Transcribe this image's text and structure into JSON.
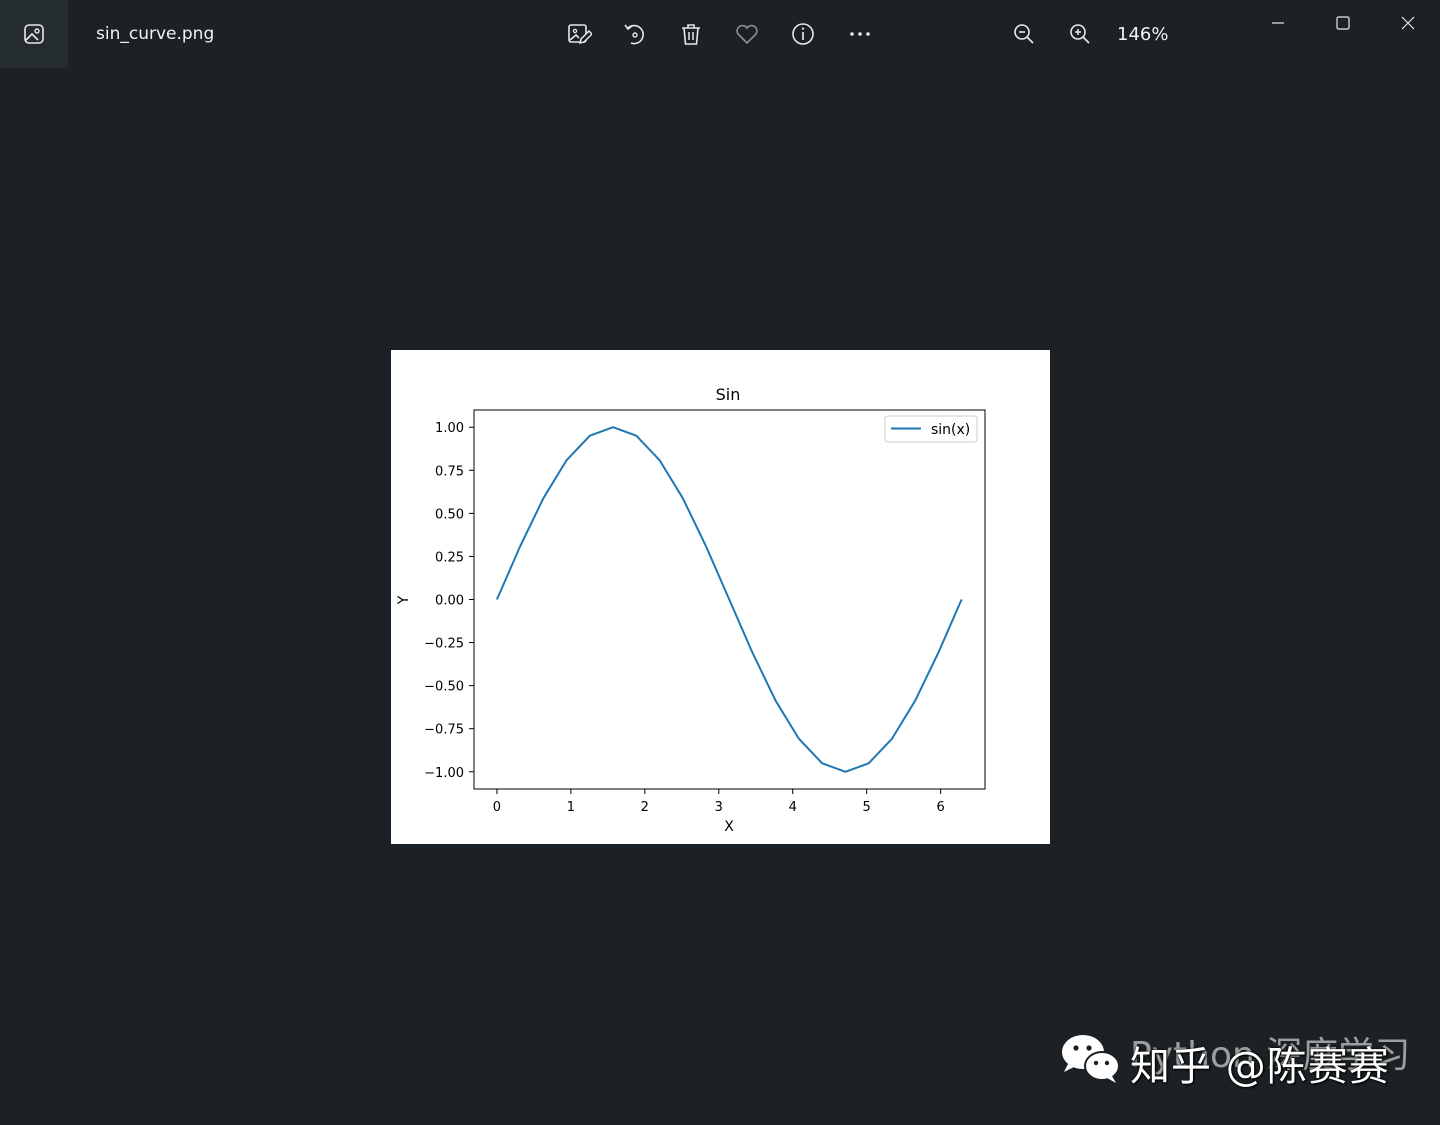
{
  "window": {
    "filename": "sin_curve.png",
    "zoom_level": "146%",
    "toolbar": {
      "edit_icon": "edit-image-icon",
      "rotate_icon": "rotate-icon",
      "delete_icon": "delete-icon",
      "favorite_icon": "heart-icon",
      "info_icon": "info-icon",
      "more_icon": "more-icon",
      "zoom_out_icon": "zoom-out-icon",
      "zoom_in_icon": "zoom-in-icon"
    },
    "controls": [
      "minimize-icon",
      "maximize-icon",
      "close-icon"
    ]
  },
  "chart_data": {
    "type": "line",
    "title": "Sin",
    "xlabel": "X",
    "ylabel": "Y",
    "xlim": [
      -0.31,
      6.6
    ],
    "ylim": [
      -1.1,
      1.1
    ],
    "x_ticks": [
      "0",
      "1",
      "2",
      "3",
      "4",
      "5",
      "6"
    ],
    "y_ticks": [
      "1.00",
      "0.75",
      "0.50",
      "0.25",
      "0.00",
      "−0.25",
      "−0.50",
      "−0.75",
      "−1.00"
    ],
    "legend": {
      "position": "upper-right"
    },
    "grid": false,
    "series": [
      {
        "name": "sin(x)",
        "color": "#1f77b4",
        "x": [
          0,
          0.3142,
          0.6283,
          0.9425,
          1.2566,
          1.5708,
          1.885,
          2.1991,
          2.5133,
          2.8274,
          3.1416,
          3.4558,
          3.7699,
          4.0841,
          4.3982,
          4.7124,
          5.0265,
          5.3407,
          5.6549,
          5.969,
          6.2832
        ],
        "y": [
          0,
          0.309,
          0.588,
          0.809,
          0.951,
          1.0,
          0.951,
          0.809,
          0.588,
          0.309,
          0,
          -0.309,
          -0.588,
          -0.809,
          -0.951,
          -1.0,
          -0.951,
          -0.809,
          -0.588,
          -0.309,
          0
        ]
      }
    ]
  },
  "watermark": {
    "text": "知乎 @陈赛赛",
    "ghost_text": "Python 深度学习"
  }
}
